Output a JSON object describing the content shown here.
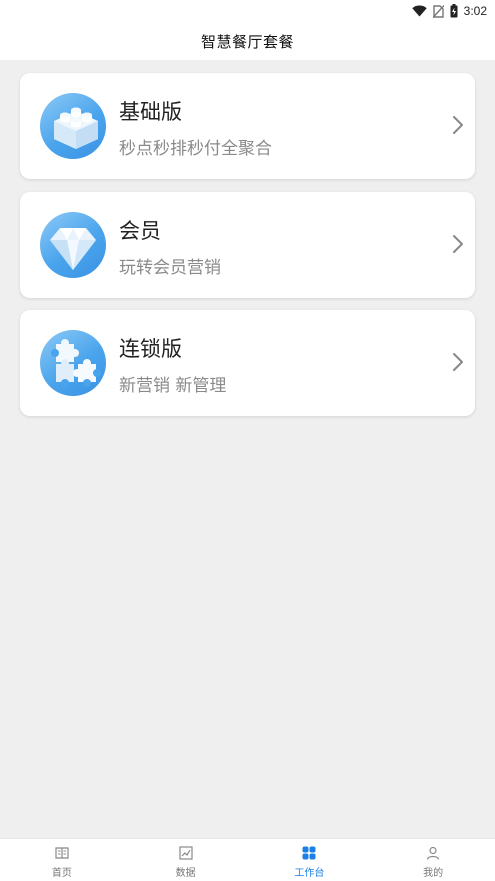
{
  "status_bar": {
    "time": "3:02",
    "icons": [
      "wifi-icon",
      "no-sim-icon",
      "battery-charging-icon"
    ]
  },
  "header": {
    "title": "智慧餐厅套餐"
  },
  "plans": [
    {
      "title": "基础版",
      "subtitle": "秒点秒排秒付全聚合",
      "icon": "lego-brick-icon"
    },
    {
      "title": "会员",
      "subtitle": "玩转会员营销",
      "icon": "diamond-icon"
    },
    {
      "title": "连锁版",
      "subtitle": "新营销 新管理",
      "icon": "puzzle-icon"
    }
  ],
  "tabs": [
    {
      "label": "首页",
      "icon": "home-icon"
    },
    {
      "label": "数据",
      "icon": "chart-icon"
    },
    {
      "label": "工作台",
      "icon": "workbench-icon",
      "active": true
    },
    {
      "label": "我的",
      "icon": "profile-icon"
    }
  ],
  "colors": {
    "accent": "#1a7fe6",
    "icon_circle": "#4aa4ec",
    "background": "#efefef"
  }
}
